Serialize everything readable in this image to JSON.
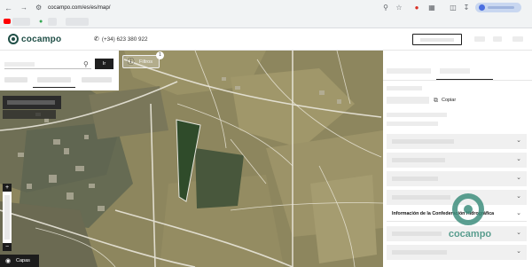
{
  "browser": {
    "back_icon": "arrow-left-icon",
    "url": "cocampo.com/es/es/map/",
    "icons": [
      "search-icon",
      "star-icon",
      "extension-icon",
      "puzzle-icon",
      "sidebar-icon",
      "download-icon"
    ]
  },
  "header": {
    "logo_text": "cocampo",
    "phone": "(+34) 623 380 922",
    "whatsapp_icon": "whatsapp-icon"
  },
  "search": {
    "go_label": "Ir"
  },
  "map": {
    "filter_label": "Filtros",
    "filter_badge": "1",
    "zoom_in": "+",
    "zoom_out": "−",
    "layers_label": "Capas"
  },
  "panel": {
    "copy_label": "Copiar",
    "section_active": "Información de la Confederación Hidrográfica",
    "watermark_text": "cocampo"
  },
  "colors": {
    "brand": "#1f4e46",
    "brand_watermark": "#3f8f7e",
    "button_dark": "#1c1c1c"
  }
}
